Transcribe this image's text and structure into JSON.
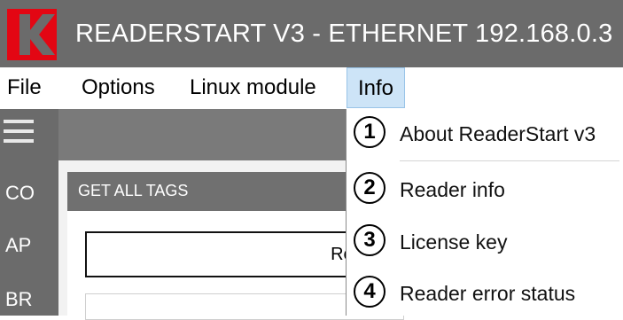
{
  "window": {
    "title": "READERSTART V3 - ETHERNET 192.168.0.3",
    "logo_color": "#e30613",
    "titlebar_color": "#6b6b6b"
  },
  "menubar": {
    "items": [
      {
        "label": "File"
      },
      {
        "label": "Options"
      },
      {
        "label": "Linux module"
      },
      {
        "label": "Info"
      }
    ],
    "active": "Info"
  },
  "sidebar": {
    "icon": "hamburger-menu-icon",
    "items": [
      {
        "label": "CO"
      },
      {
        "label": "AP"
      },
      {
        "label": "BR"
      }
    ]
  },
  "main": {
    "panel_title": "GET ALL TAGS",
    "refresh_label": "Refre"
  },
  "info_menu": {
    "items": [
      {
        "number": "1",
        "label": "About ReaderStart v3"
      },
      {
        "number": "2",
        "label": "Reader info"
      },
      {
        "number": "3",
        "label": "License key"
      },
      {
        "number": "4",
        "label": "Reader error status"
      }
    ]
  }
}
